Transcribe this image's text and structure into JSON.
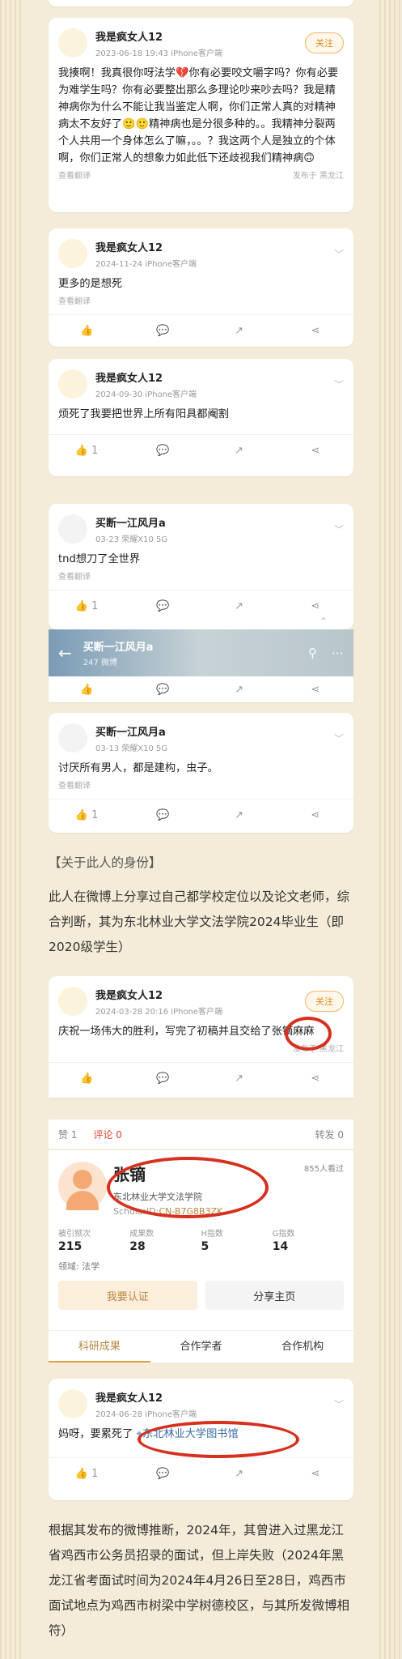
{
  "posts": [
    {
      "name": "我是疯女人12",
      "meta": "2023-06-18 19:43  iPhone客户端",
      "follow": "关注",
      "text": "我揍啊！我真很你呀法学💔你有必要咬文嚼字吗？你有必要为难学生吗？你有必要整出那么多理论吵来吵去吗？我是精神病你为什么不能让我当鉴定人啊，你们正常人真的对精神病太不友好了🙂🙂精神病也是分很多种的。。我精神分裂两个人共用一个身体怎么了嘛，。。？我这两个人是独立的个体啊，你们正常人的想象力如此低下还歧视我们精神病🙃",
      "translate": "查看翻译",
      "region": "发布于 黑龙江"
    },
    {
      "name": "我是疯女人12",
      "meta": "2024-11-24  iPhone客户端",
      "text": "更多的是想死",
      "translate": "查看翻译"
    },
    {
      "name": "我是疯女人12",
      "meta": "2024-09-30  iPhone客户端",
      "text": "烦死了我要把世界上所有阳具都阉割",
      "like": "1"
    },
    {
      "name": "买断一江风月a",
      "meta": "03-23  荣耀X10 5G",
      "text": "tnd想刀了全世界",
      "translate": "查看翻译",
      "like": "1"
    },
    {
      "name": "买断一江风月a",
      "meta": "03-13  荣耀X10 5G",
      "text": "讨厌所有男人，都是建构，虫子。",
      "translate": "查看翻译",
      "like": "1"
    }
  ],
  "weibo_header": {
    "title": "买断一江风月a",
    "sub": "247 微博"
  },
  "section_head": "【关于此人的身份】",
  "section_text": "此人在微博上分享过自己都学校定位以及论文老师，综合判断，其为东北林业大学文法学院2024毕业生（即2020级学生）",
  "post6": {
    "name": "我是疯女人12",
    "meta": "2024-03-28 20:16  iPhone客户端",
    "follow": "关注",
    "text": "庆祝一场伟大的胜利，写完了初稿并且交给了张镝麻麻",
    "region": "发布于 黑龙江"
  },
  "stats": {
    "like": "赞 1",
    "comment": "评论 0",
    "repost": "转发 0"
  },
  "profile": {
    "name": "张镝",
    "inst": "东北林业大学文法学院",
    "id_label": "ScholarID:",
    "id": "CN-B7G8B3ZK",
    "views": "855人看过",
    "k1": "被引频次",
    "v1": "215",
    "k2": "成果数",
    "v2": "28",
    "k3": "H指数",
    "v3": "5",
    "k4": "G指数",
    "v4": "14",
    "field": "领域: 法学",
    "btn1": "我要认证",
    "btn2": "分享主页",
    "tab1": "科研成果",
    "tab2": "合作学者",
    "tab3": "合作机构"
  },
  "post7": {
    "name": "我是疯女人12",
    "meta": "2024-06-28  iPhone客户端",
    "text": "妈呀，要累死了",
    "loc": "东北林业大学图书馆",
    "like": "1"
  },
  "closing": "根据其发布的微博推断，2024年，其曾进入过黑龙江省鸡西市公务员招录的面试，但上岸失败（2024年黑龙江省考面试时间为2024年4月26日至28日，鸡西市面试地点为鸡西市树梁中学树德校区，与其所发微博相符）"
}
